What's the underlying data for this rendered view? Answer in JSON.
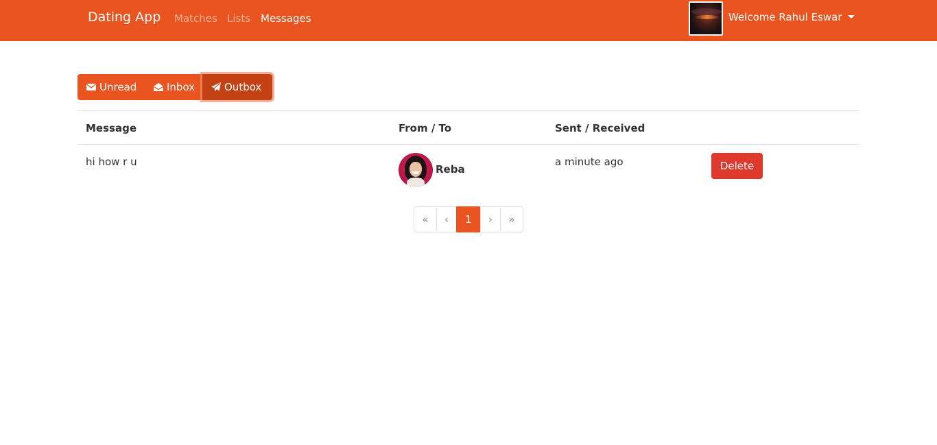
{
  "navbar": {
    "brand": "Dating App",
    "links": [
      {
        "label": "Matches",
        "active": false
      },
      {
        "label": "Lists",
        "active": false
      },
      {
        "label": "Messages",
        "active": true
      }
    ],
    "user_menu_label": "Welcome Rahul Eswar",
    "background_color": "#e95420"
  },
  "message_tabs": [
    {
      "label": "Unread",
      "icon": "envelope-icon",
      "active": false
    },
    {
      "label": "Inbox",
      "icon": "envelope-open-icon",
      "active": false
    },
    {
      "label": "Outbox",
      "icon": "paper-plane-icon",
      "active": true
    }
  ],
  "table": {
    "headers": [
      "Message",
      "From / To",
      "Sent / Received"
    ],
    "rows": [
      {
        "message": "hi how r u",
        "recipient": "Reba",
        "time": "a minute ago",
        "action": "Delete"
      }
    ]
  },
  "pagination": {
    "first": "«",
    "prev": "‹",
    "current": "1",
    "next": "›",
    "last": "»"
  },
  "colors": {
    "primary": "#e95420",
    "primary_active": "#c34113",
    "danger": "#df382c"
  }
}
